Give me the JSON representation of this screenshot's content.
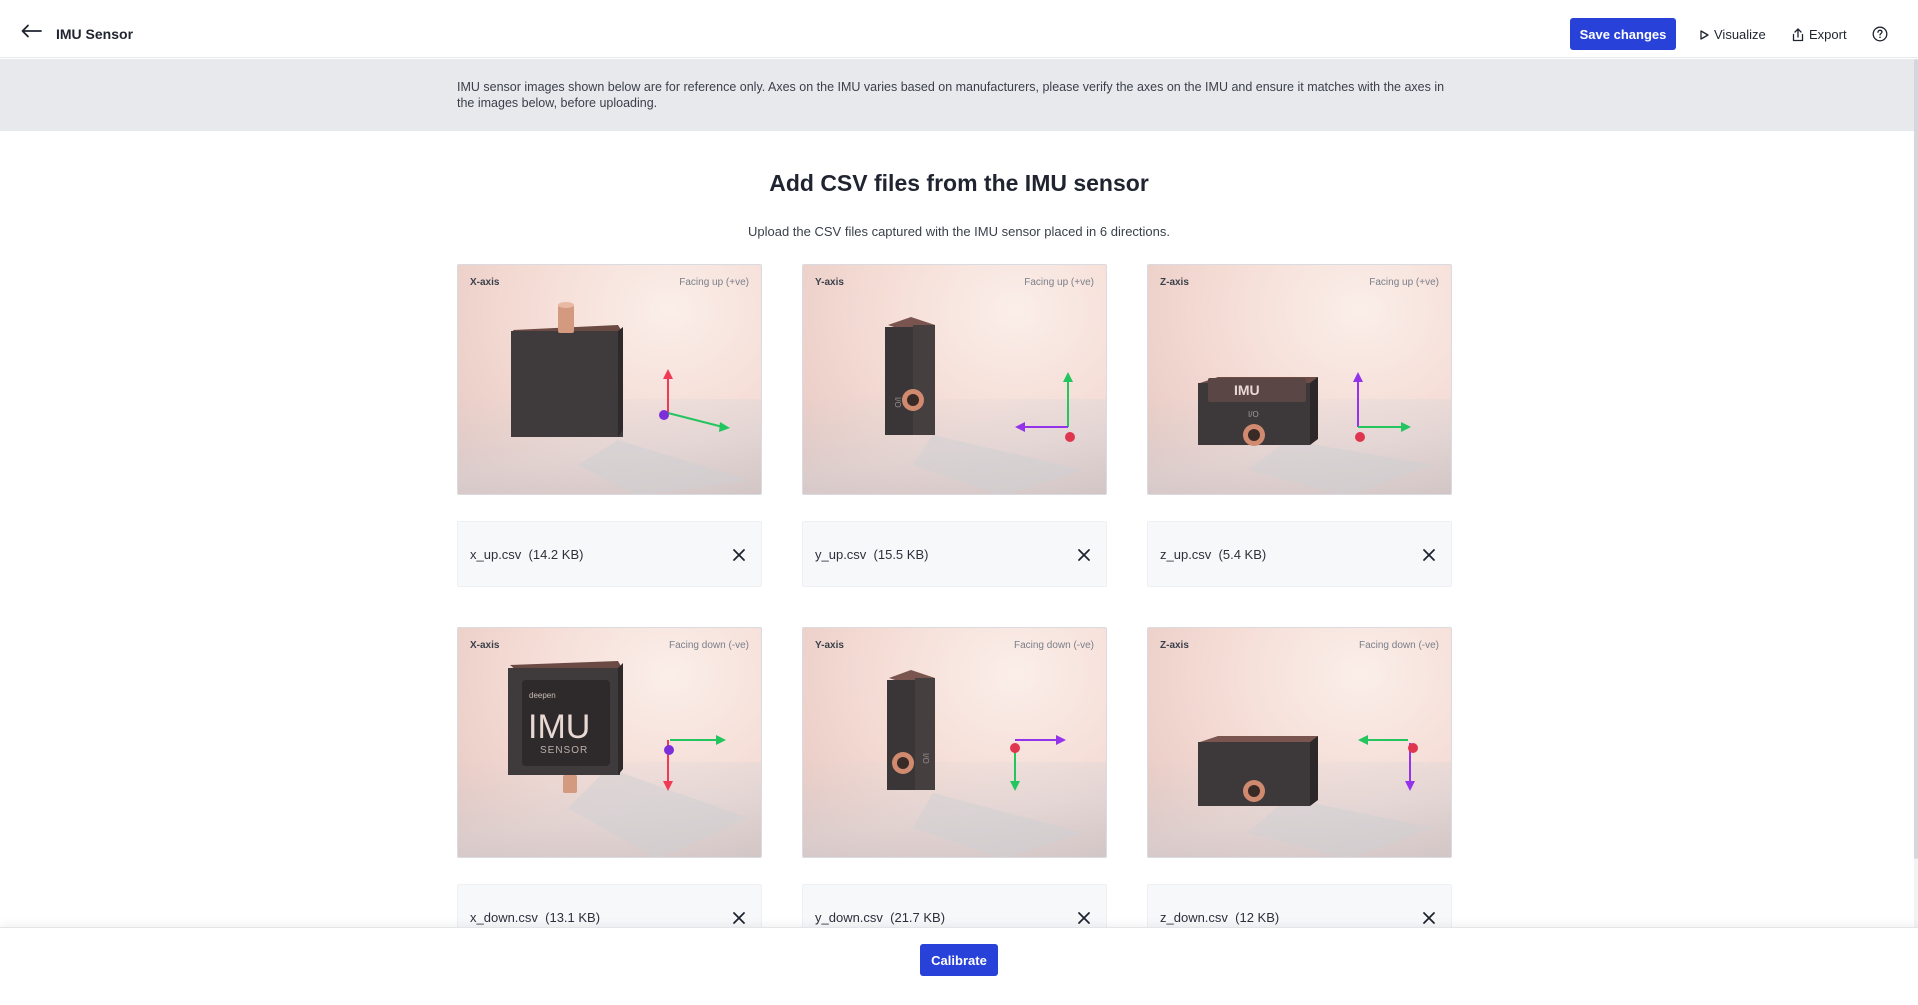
{
  "header": {
    "title": "IMU Sensor",
    "back_icon": "arrow-left-icon",
    "save_label": "Save changes",
    "visualize_label": "Visualize",
    "export_label": "Export",
    "help_icon": "question-circle-icon",
    "accent_color": "#2741d9"
  },
  "banner": {
    "text": "IMU sensor images shown below are for reference only. Axes on the IMU varies based on manufacturers, please verify the axes on the IMU and ensure it matches with the axes in the images below, before uploading."
  },
  "main": {
    "title": "Add CSV files from the IMU sensor",
    "subtitle": "Upload the CSV files captured with the IMU sensor placed in 6 directions."
  },
  "cards": [
    {
      "axis": "X-axis",
      "direction": "Facing up (+ve)",
      "file": "x_up.csv  (14.2 KB)"
    },
    {
      "axis": "Y-axis",
      "direction": "Facing up (+ve)",
      "file": "y_up.csv  (15.5 KB)"
    },
    {
      "axis": "Z-axis",
      "direction": "Facing up (+ve)",
      "file": "z_up.csv  (5.4 KB)"
    },
    {
      "axis": "X-axis",
      "direction": "Facing down (-ve)",
      "file": "x_down.csv  (13.1 KB)"
    },
    {
      "axis": "Y-axis",
      "direction": "Facing down (-ve)",
      "file": "y_down.csv  (21.7 KB)"
    },
    {
      "axis": "Z-axis",
      "direction": "Facing down (-ve)",
      "file": "z_down.csv  (12 KB)"
    }
  ],
  "sensor_label": {
    "brand": "deepen",
    "name": "IMU",
    "sub": "SENSOR",
    "port": "I/O"
  },
  "footer": {
    "calibrate_label": "Calibrate"
  }
}
